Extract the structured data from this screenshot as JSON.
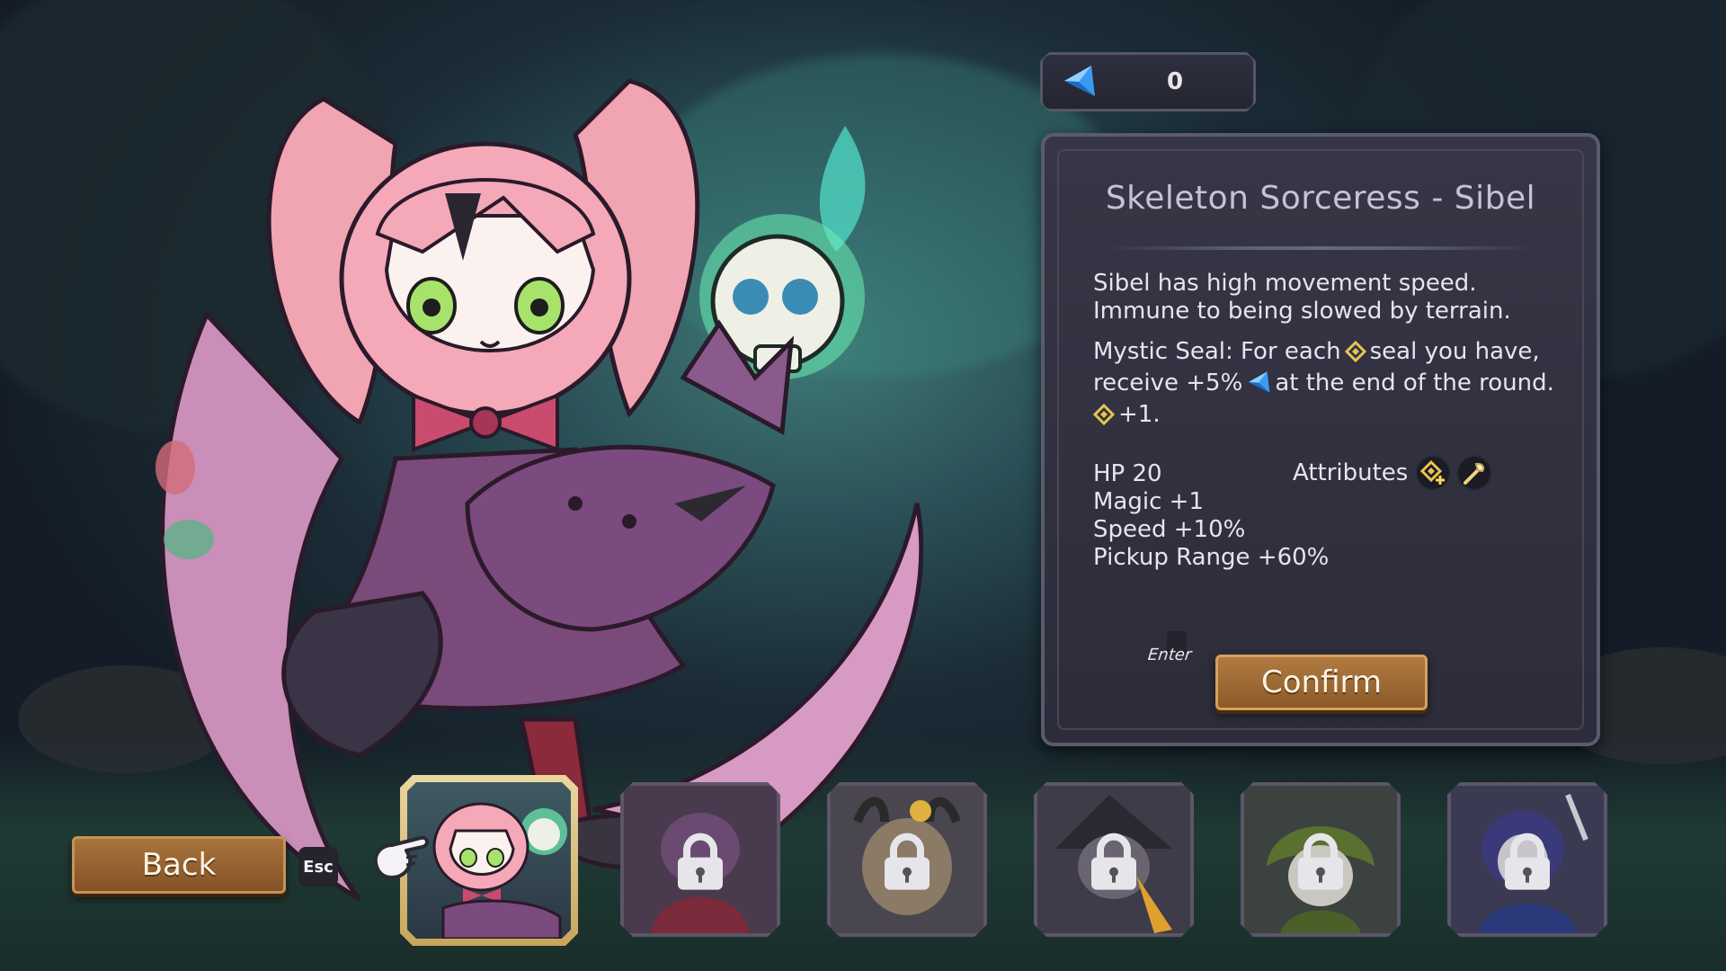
{
  "currency": {
    "icon": "blue-gem-icon",
    "value": "0"
  },
  "character": {
    "title": "Skeleton Sorceress - Sibel",
    "desc_line1": "Sibel has high movement speed.",
    "desc_line2": "Immune to being slowed by terrain.",
    "seal_a": "Mystic Seal: For each",
    "seal_b": "seal you have,",
    "seal_c": "receive +5%",
    "seal_d": "at the end of the round.",
    "seal_e": "+1.",
    "stats": {
      "hp": "HP 20",
      "magic": "Magic +1",
      "speed": "Speed +10%",
      "pickup": "Pickup Range +60%"
    },
    "attributes_label": "Attributes",
    "attribute_icons": [
      "seal-plus-icon",
      "staff-icon"
    ]
  },
  "controls": {
    "confirm_label": "Confirm",
    "confirm_key": "Enter",
    "back_label": "Back",
    "back_key": "Esc"
  },
  "roster": [
    {
      "name": "Sibel",
      "locked": false,
      "selected": true
    },
    {
      "name": "slot-2",
      "locked": true
    },
    {
      "name": "slot-3",
      "locked": true
    },
    {
      "name": "slot-4",
      "locked": true
    },
    {
      "name": "slot-5",
      "locked": true
    },
    {
      "name": "slot-6",
      "locked": true
    }
  ],
  "colors": {
    "panel": "#323242",
    "button_gold": "#a8743c",
    "gem_blue": "#3a9cf0",
    "seal_gold": "#e8c550"
  }
}
